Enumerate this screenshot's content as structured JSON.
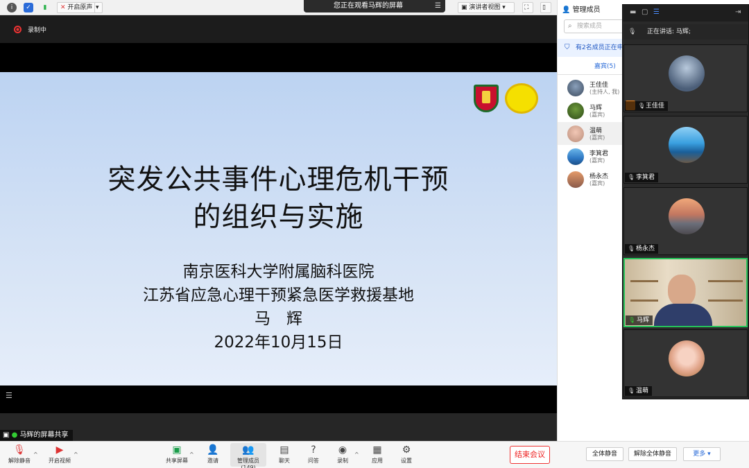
{
  "topbar": {
    "original_sound_label": "开启原声",
    "presenter_view_label": "演讲者视图",
    "watching_banner": "您正在观看马辉的屏幕"
  },
  "recording": {
    "label": "录制中"
  },
  "slide": {
    "title_line1": "突发公共事件心理危机干预",
    "title_line2": "的组织与实施",
    "org_line1": "南京医科大学附属脑科医院",
    "org_line2": "江苏省应急心理干预紧急医学救援基地",
    "author": "马　辉",
    "date": "2022年10月15日"
  },
  "share_label": "马辉的屏幕共享",
  "toolbar": {
    "unmute": "解除静音",
    "start_video": "开启视频",
    "share_screen": "共享屏幕",
    "invite": "邀请",
    "manage_members": "管理成员(149)",
    "chat": "聊天",
    "qa": "问答",
    "record": "录制",
    "apps": "应用",
    "settings": "设置",
    "end_meeting": "结束会议",
    "mute_all": "全体静音",
    "unmute_all": "解除全体静音",
    "more": "更多"
  },
  "member_panel": {
    "title": "管理成员",
    "search_placeholder": "搜索成员",
    "notice": "有2名成员正在申",
    "tab_guests": "嘉宾(5)",
    "members": [
      {
        "name": "王佳佳",
        "role": "(主持人, 我)"
      },
      {
        "name": "马辉",
        "role": "(嘉宾)"
      },
      {
        "name": "温萌",
        "role": "(嘉宾)"
      },
      {
        "name": "李箕君",
        "role": "(嘉宾)"
      },
      {
        "name": "杨永杰",
        "role": "(嘉宾)"
      }
    ]
  },
  "gallery": {
    "speaking": "正在讲话: 马辉;",
    "tiles": [
      {
        "name": "王佳佳"
      },
      {
        "name": "李箕君"
      },
      {
        "name": "杨永杰"
      },
      {
        "name": "马辉"
      },
      {
        "name": "温萌"
      }
    ]
  },
  "colors": {
    "accent": "#2a6bd8",
    "end_red": "#e22222",
    "active_speaker": "#26c55a",
    "slide_bg": "#c7daf4"
  }
}
